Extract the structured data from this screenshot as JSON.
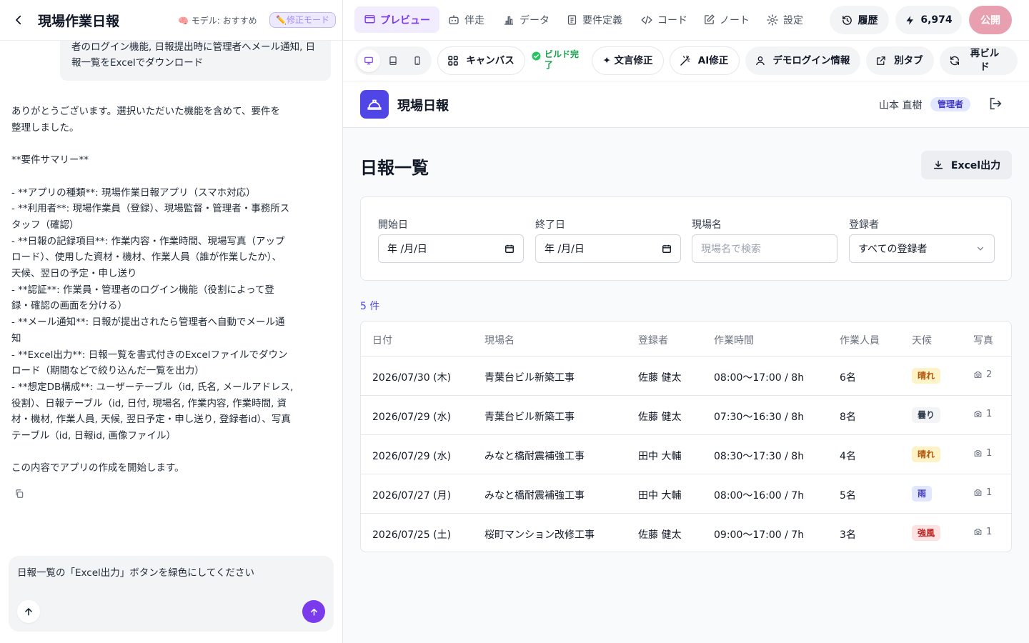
{
  "left": {
    "title": "現場作業日報",
    "model_label": "🧠 モデル: おすすめ",
    "fix_mode_label": "✏️修正モード",
    "user_message": "者のログイン機能, 日報提出時に管理者へメール通知, 日報一覧をExcelでダウンロード",
    "assistant_message": "ありがとうございます。選択いただいた機能を含めて、要件を\n整理しました。\n\n**要件サマリー**\n\n- **アプリの種類**: 現場作業日報アプリ（スマホ対応）\n- **利用者**: 現場作業員（登録）、現場監督・管理者・事務所ス\nタッフ（確認）\n- **日報の記録項目**: 作業内容・作業時間、現場写真（アップ\nロード）、使用した資材・機材、作業人員（誰が作業したか）、\n天候、翌日の予定・申し送り\n- **認証**: 作業員・管理者のログイン機能（役割によって登\n録・確認の画面を分ける）\n- **メール通知**: 日報が提出されたら管理者へ自動でメール通\n知\n- **Excel出力**: 日報一覧を書式付きのExcelファイルでダウン\nロード（期間などで絞り込んだ一覧を出力）\n- **想定DB構成**: ユーザーテーブル（id, 氏名, メールアドレス,\n役割）、日報テーブル（id, 日付, 現場名, 作業内容, 作業時間, 資\n材・機材, 作業人員, 天候, 翌日予定・申し送り, 登録者id）、写真\nテーブル（id, 日報id, 画像ファイル）\n\nこの内容でアプリの作成を開始します。",
    "composer_text": "日報一覧の「Excel出力」ボタンを緑色にしてください"
  },
  "top_tabs": [
    {
      "label": "プレビュー",
      "icon": "monitor-icon",
      "active": true
    },
    {
      "label": "伴走",
      "icon": "robot-icon"
    },
    {
      "label": "データ",
      "icon": "bar-chart-icon"
    },
    {
      "label": "要件定義",
      "icon": "clipboard-icon"
    },
    {
      "label": "コード",
      "icon": "code-icon"
    },
    {
      "label": "ノート",
      "icon": "edit-note-icon"
    },
    {
      "label": "設定",
      "icon": "gear-icon"
    }
  ],
  "header_actions": {
    "history_label": "履歴",
    "credits": "6,974",
    "publish_label": "公開"
  },
  "toolbar": {
    "canvas_label": "キャンバス",
    "build_status": "ビルド完了",
    "text_fix_label": "✦ 文言修正",
    "ai_fix_label": "AI修正",
    "demo_login_label": "デモログイン情報",
    "new_tab_label": "別タブ",
    "rebuild_label": "再ビルド"
  },
  "app": {
    "name": "現場日報",
    "user_name": "山本 直樹",
    "role": "管理者",
    "page_title": "日報一覧",
    "excel_button": "Excel出力",
    "filters": {
      "start_label": "開始日",
      "start_value": "年 /月/日",
      "end_label": "終了日",
      "end_value": "年 /月/日",
      "site_label": "現場名",
      "site_placeholder": "現場名で検索",
      "reporter_label": "登録者",
      "reporter_value": "すべての登録者"
    },
    "count": "5 件",
    "columns": [
      "日付",
      "現場名",
      "登録者",
      "作業時間",
      "作業人員",
      "天候",
      "写真"
    ],
    "rows": [
      {
        "date": "2026/07/30 (木)",
        "site": "青葉台ビル新築工事",
        "reporter": "佐藤 健太",
        "hours": "08:00〜17:00 / 8h",
        "workers": "6名",
        "weather": "晴れ",
        "photos": "2"
      },
      {
        "date": "2026/07/29 (水)",
        "site": "青葉台ビル新築工事",
        "reporter": "佐藤 健太",
        "hours": "07:30〜16:30 / 8h",
        "workers": "8名",
        "weather": "曇り",
        "photos": "1"
      },
      {
        "date": "2026/07/29 (水)",
        "site": "みなと橋耐震補強工事",
        "reporter": "田中 大輔",
        "hours": "08:30〜17:30 / 8h",
        "workers": "4名",
        "weather": "晴れ",
        "photos": "1"
      },
      {
        "date": "2026/07/27 (月)",
        "site": "みなと橋耐震補強工事",
        "reporter": "田中 大輔",
        "hours": "08:00〜16:00 / 7h",
        "workers": "5名",
        "weather": "雨",
        "photos": "1"
      },
      {
        "date": "2026/07/25 (土)",
        "site": "桜町マンション改修工事",
        "reporter": "佐藤 健太",
        "hours": "09:00〜17:00 / 7h",
        "workers": "3名",
        "weather": "強風",
        "photos": "1"
      }
    ],
    "weather_colors": {
      "晴れ": {
        "bg": "#fef3c7",
        "fg": "#b45309"
      },
      "曇り": {
        "bg": "#f3f4f6",
        "fg": "#374151"
      },
      "雨": {
        "bg": "#e0e7ff",
        "fg": "#4338ca"
      },
      "強風": {
        "bg": "#fee2e2",
        "fg": "#b91c1c"
      }
    }
  },
  "colors": {
    "accent": "#7c3aed",
    "app_primary": "#4f46e5",
    "publish": "#e8a0b0",
    "build_ok": "#16a34a"
  }
}
